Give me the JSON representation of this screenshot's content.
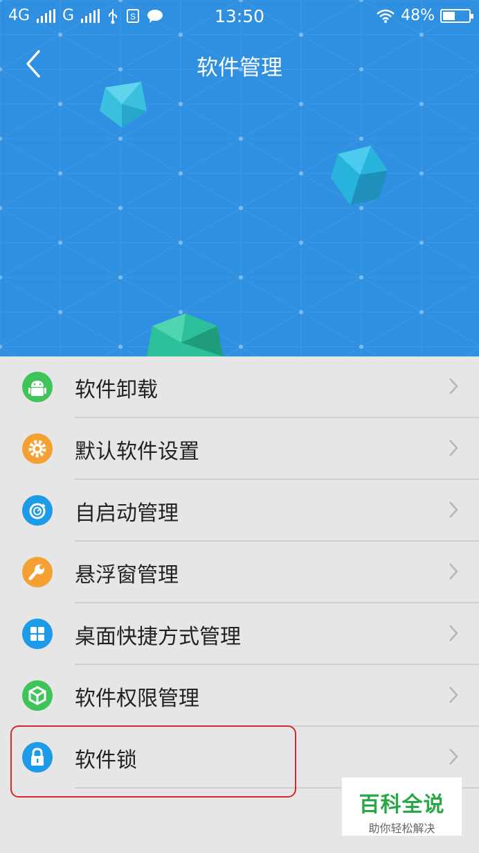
{
  "status_bar": {
    "network_primary": "4G",
    "network_secondary": "G",
    "time": "13:50",
    "battery": "48%",
    "battery_level": 0.48,
    "icons": [
      "signal-icon",
      "usb-icon",
      "sim-icon",
      "message-icon",
      "wifi-icon",
      "battery-icon"
    ]
  },
  "header": {
    "title": "软件管理",
    "back_icon": "back-arrow-icon",
    "background_color": "#2f8fe0"
  },
  "menu": {
    "items": [
      {
        "label": "软件卸载",
        "icon": "android-icon",
        "color": "#3fc45a"
      },
      {
        "label": "默认软件设置",
        "icon": "gear-icon",
        "color": "#f5a033"
      },
      {
        "label": "自启动管理",
        "icon": "startup-icon",
        "color": "#1e9be8"
      },
      {
        "label": "悬浮窗管理",
        "icon": "wrench-icon",
        "color": "#f5a033"
      },
      {
        "label": "桌面快捷方式管理",
        "icon": "grid-icon",
        "color": "#1e9be8"
      },
      {
        "label": "软件权限管理",
        "icon": "shield-icon",
        "color": "#3fc45a"
      },
      {
        "label": "软件锁",
        "icon": "lock-icon",
        "color": "#1e9be8"
      }
    ],
    "highlight_color": "#d9252a"
  },
  "watermark": {
    "main": "百科全说",
    "sub": "助你轻松解决"
  }
}
